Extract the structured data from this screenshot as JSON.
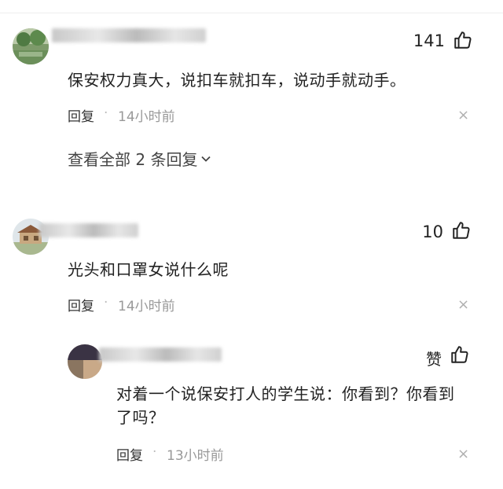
{
  "comments": [
    {
      "likes": "141",
      "text": "保安权力真大，说扣车就扣车，说动手就动手。",
      "reply_label": "回复",
      "separator": "·",
      "time": "14小时前",
      "close": "×",
      "view_all": "查看全部 2 条回复"
    },
    {
      "likes": "10",
      "text": "光头和口罩女说什么呢",
      "reply_label": "回复",
      "separator": "·",
      "time": "14小时前",
      "close": "×"
    }
  ],
  "reply": {
    "like_label": "赞",
    "text_line1": "对着一个说保安打人的学生说：你看到？你看到",
    "text_line2": "了吗？",
    "reply_label": "回复",
    "separator": "·",
    "time": "13小时前",
    "close": "×"
  },
  "icons": {
    "like": "thumbs-up-icon",
    "chevron": "chevron-down-icon",
    "close": "close-icon"
  },
  "colors": {
    "text": "#222222",
    "meta": "#999999",
    "close": "#b0b0b0"
  }
}
